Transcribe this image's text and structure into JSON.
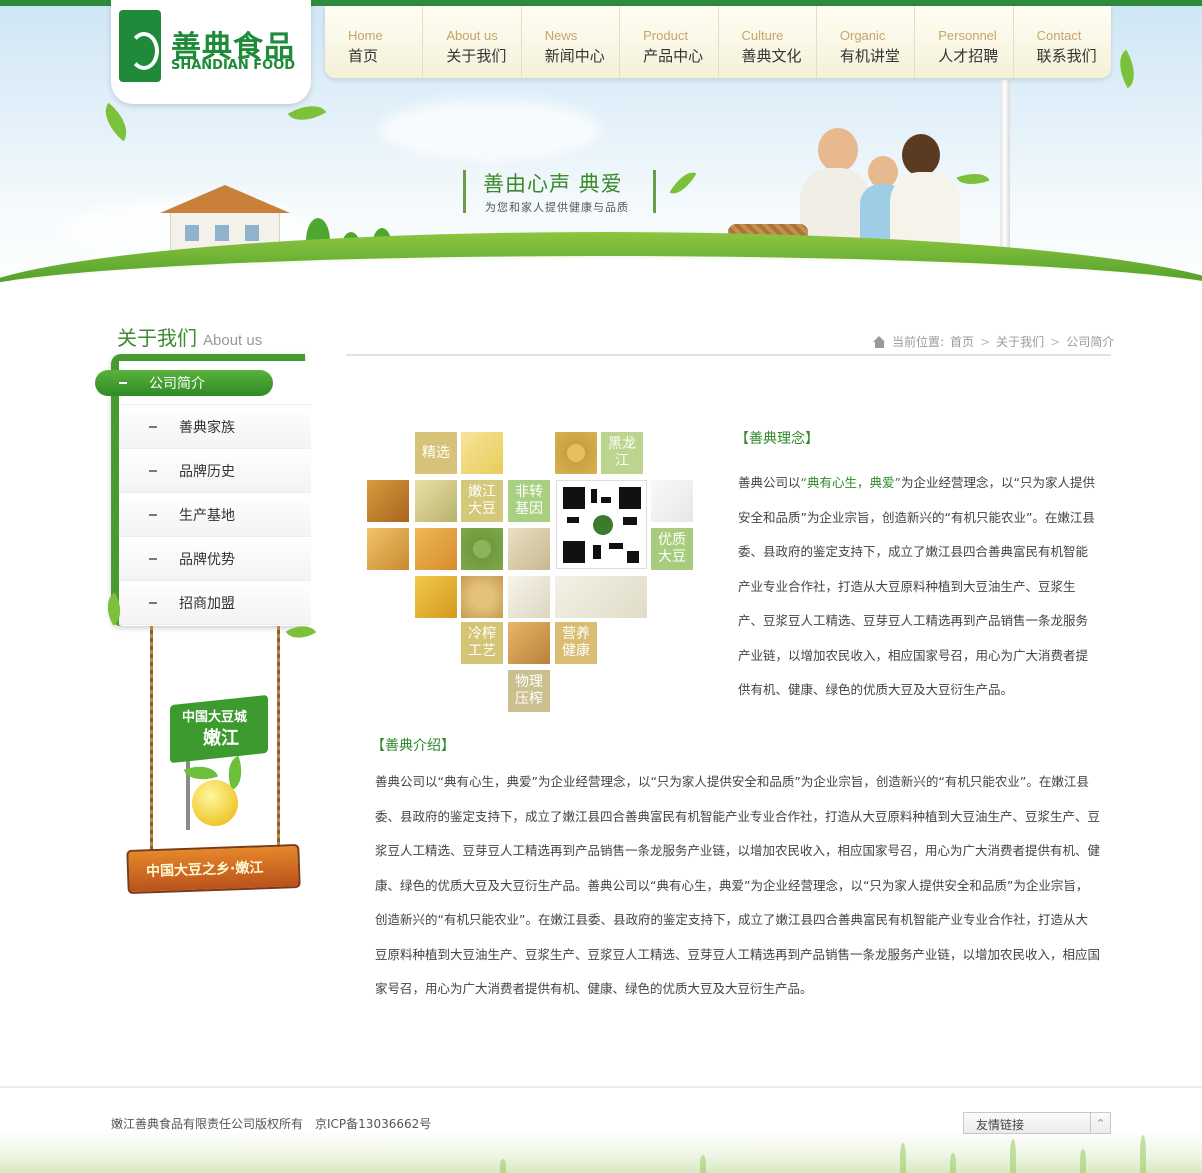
{
  "brand": {
    "name_cn": "善典食品",
    "name_en": "SHANDIAN FOOD"
  },
  "nav": [
    {
      "en": "Home",
      "cn": "首页"
    },
    {
      "en": "About us",
      "cn": "关于我们"
    },
    {
      "en": "News",
      "cn": "新闻中心"
    },
    {
      "en": "Product",
      "cn": "产品中心"
    },
    {
      "en": "Culture",
      "cn": "善典文化"
    },
    {
      "en": "Organic",
      "cn": "有机讲堂"
    },
    {
      "en": "Personnel",
      "cn": "人才招聘"
    },
    {
      "en": "Contact",
      "cn": "联系我们"
    }
  ],
  "banner": {
    "slogan": "善由心声  典爱",
    "subtitle": "为您和家人提供健康与品质"
  },
  "sidebar": {
    "title_cn": "关于我们",
    "title_en": "About us",
    "items": [
      {
        "label": "公司简介",
        "active": true
      },
      {
        "label": "善典家族",
        "active": false
      },
      {
        "label": "品牌历史",
        "active": false
      },
      {
        "label": "生产基地",
        "active": false
      },
      {
        "label": "品牌优势",
        "active": false
      },
      {
        "label": "招商加盟",
        "active": false
      }
    ],
    "promo": {
      "flag_line1": "中国大豆城",
      "flag_line2": "嫩江",
      "sign": "中国大豆之乡·嫩江"
    }
  },
  "breadcrumb": {
    "prefix": "当前位置:",
    "items": [
      "首页",
      "关于我们",
      "公司简介"
    ]
  },
  "product_grid": {
    "labels": [
      "精选",
      "黑龙江",
      "嫩江大豆",
      "非转基因",
      "优质大豆",
      "冷榨工艺",
      "营养健康",
      "物理压榨"
    ]
  },
  "content": {
    "section1_title": "【善典理念】",
    "section1_p_a": "善典公司以",
    "section1_p_hl": "“典有心生，典爱”",
    "section1_p_b": "为企业经营理念，以“只为家人提供安全和品质”为企业宗旨，创造新兴的“有机只能农业”。在嫩江县委、县政府的鉴定支持下，成立了嫩江县四合善典富民有机智能产业专业合作社，打造从大豆原料种植到大豆油生产、豆浆生产、豆浆豆人工精选、豆芽豆人工精选再到产品销售一条龙服务产业链，以增加农民收入，相应国家号召，用心为广大消费者提供有机、健康、绿色的优质大豆及大豆衍生产品。",
    "section2_title": "【善典介绍】",
    "section2_p": "善典公司以“典有心生，典爱”为企业经营理念，以“只为家人提供安全和品质”为企业宗旨，创造新兴的“有机只能农业”。在嫩江县委、县政府的鉴定支持下，成立了嫩江县四合善典富民有机智能产业专业合作社，打造从大豆原料种植到大豆油生产、豆浆生产、豆浆豆人工精选、豆芽豆人工精选再到产品销售一条龙服务产业链，以增加农民收入，相应国家号召，用心为广大消费者提供有机、健康、绿色的优质大豆及大豆衍生产品。善典公司以“典有心生，典爱”为企业经营理念，以“只为家人提供安全和品质”为企业宗旨，创造新兴的“有机只能农业”。在嫩江县委、县政府的鉴定支持下，成立了嫩江县四合善典富民有机智能产业专业合作社，打造从大豆原料种植到大豆油生产、豆浆生产、豆浆豆人工精选、豆芽豆人工精选再到产品销售一条龙服务产业链，以增加农民收入，相应国家号召，用心为广大消费者提供有机、健康、绿色的优质大豆及大豆衍生产品。"
  },
  "footer": {
    "copyright": "嫩江善典食品有限责任公司版权所有",
    "icp": "京ICP备13036662号",
    "links_label": "友情链接"
  },
  "colors": {
    "brand_green": "#2f8a2a",
    "nav_en": "#c8a56a",
    "active_pill": "#3f9c2e"
  }
}
